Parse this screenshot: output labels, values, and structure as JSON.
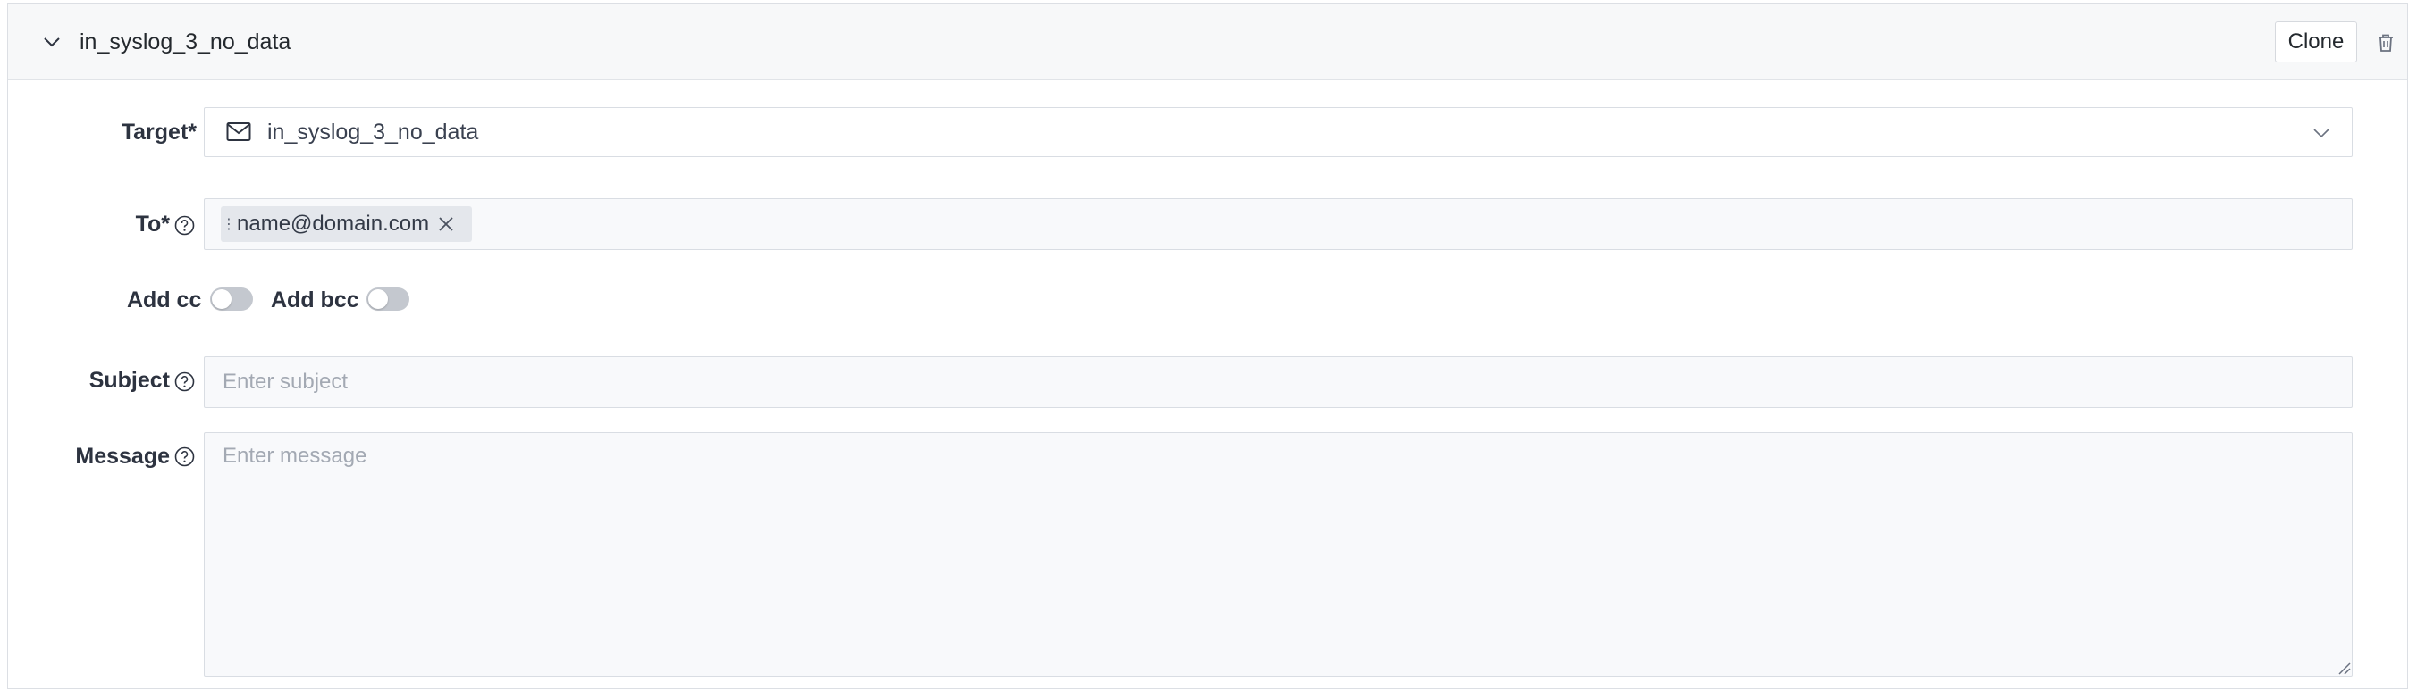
{
  "header": {
    "title": "in_syslog_3_no_data",
    "clone_label": "Clone",
    "collapse_icon": "chevron-down-icon",
    "delete_icon": "trash-icon"
  },
  "form": {
    "target": {
      "label": "Target*",
      "value": "in_syslog_3_no_data",
      "icon": "mail-icon"
    },
    "to": {
      "label": "To*",
      "chips": [
        "name@domain.com"
      ]
    },
    "add_cc": {
      "label": "Add cc",
      "enabled": false
    },
    "add_bcc": {
      "label": "Add bcc",
      "enabled": false
    },
    "subject": {
      "label": "Subject",
      "placeholder": "Enter subject",
      "value": ""
    },
    "message": {
      "label": "Message",
      "placeholder": "Enter message",
      "value": ""
    }
  },
  "colors": {
    "header_bg": "#f7f8f9",
    "field_bg": "#f8f9fb",
    "toggle_off": "#c4c8cf",
    "chip_bg": "#e4e7ec"
  }
}
